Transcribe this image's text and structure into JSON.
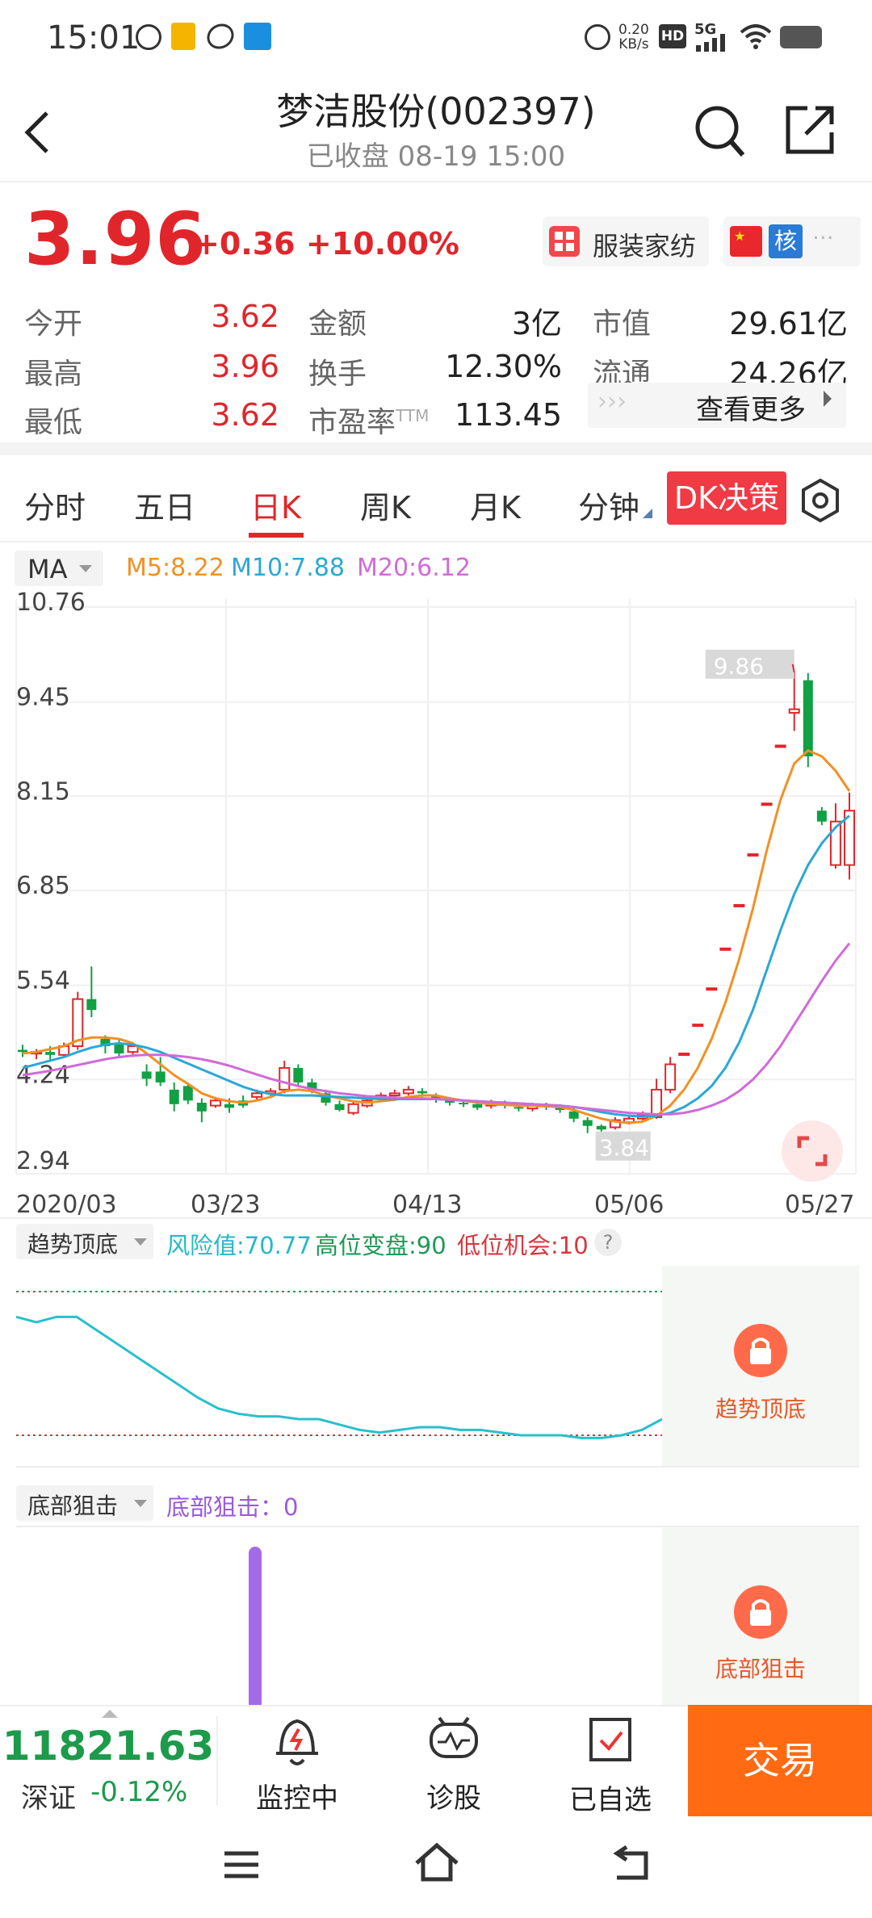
{
  "status_bar": {
    "time": "15:01",
    "net_speed_top": "0.20",
    "net_speed_bottom": "KB/s",
    "hd": "HD",
    "signal": "5G"
  },
  "header": {
    "title": "梦洁股份(002397)",
    "subtitle": "已收盘 08-19 15:00"
  },
  "quote": {
    "price": "3.96",
    "change": "+0.36",
    "change_pct": "+10.00%",
    "industry": "服装家纺",
    "badge_hu": "核",
    "dots": "···"
  },
  "stats": [
    [
      {
        "label": "今开",
        "value": "3.62",
        "red": true
      },
      {
        "label": "金额",
        "value": "3亿",
        "red": false
      },
      {
        "label": "市值",
        "value": "29.61亿",
        "red": false
      }
    ],
    [
      {
        "label": "最高",
        "value": "3.96",
        "red": true
      },
      {
        "label": "换手",
        "value": "12.30%",
        "red": false
      },
      {
        "label": "流通",
        "value": "24.26亿",
        "red": false
      }
    ],
    [
      {
        "label": "最低",
        "value": "3.62",
        "red": true
      },
      {
        "label": "市盈率",
        "label_sup": "TTM",
        "value": "113.45",
        "red": false
      },
      {
        "label": "查看更多",
        "value": "",
        "red": false
      }
    ]
  ],
  "tabs": [
    "分时",
    "五日",
    "日K",
    "周K",
    "月K",
    "分钟"
  ],
  "active_tab": "日K",
  "dk_button": "DK决策",
  "ma": {
    "selector": "MA",
    "m5": "M5:8.22",
    "m10": "M10:7.88",
    "m20": "M20:6.12",
    "c5": "#f29024",
    "c10": "#2aa8d6",
    "c20": "#d16ad8"
  },
  "chart_data": [
    {
      "type": "candlestick",
      "y_ticks": [
        "10.76",
        "9.45",
        "8.15",
        "6.85",
        "5.54",
        "4.24",
        "2.94"
      ],
      "ylim": [
        2.94,
        10.76
      ],
      "x_ticks": [
        "2020/03",
        "03/23",
        "04/13",
        "05/06",
        "05/27"
      ],
      "high_label": "9.86",
      "low_label": "3.84",
      "candles": [
        [
          4.65,
          4.62,
          4.72,
          4.55
        ],
        [
          4.6,
          4.62,
          4.66,
          4.52
        ],
        [
          4.62,
          4.58,
          4.7,
          4.5
        ],
        [
          4.58,
          4.7,
          4.75,
          4.55
        ],
        [
          4.7,
          5.35,
          5.45,
          4.65
        ],
        [
          5.35,
          5.2,
          5.8,
          5.1
        ],
        [
          4.8,
          4.7,
          4.85,
          4.6
        ],
        [
          4.75,
          4.6,
          4.8,
          4.55
        ],
        [
          4.62,
          4.7,
          4.74,
          4.55
        ],
        [
          4.35,
          4.25,
          4.45,
          4.15
        ],
        [
          4.35,
          4.2,
          4.55,
          4.15
        ],
        [
          4.1,
          3.9,
          4.2,
          3.8
        ],
        [
          4.15,
          3.95,
          4.2,
          3.9
        ],
        [
          3.92,
          3.8,
          3.98,
          3.65
        ],
        [
          3.88,
          3.95,
          4.0,
          3.85
        ],
        [
          3.9,
          3.85,
          3.98,
          3.78
        ],
        [
          3.95,
          3.88,
          4.02,
          3.85
        ],
        [
          4.0,
          4.05,
          4.1,
          3.95
        ],
        [
          4.05,
          4.08,
          4.12,
          4.0
        ],
        [
          4.1,
          4.4,
          4.5,
          4.05
        ],
        [
          4.4,
          4.2,
          4.45,
          4.15
        ],
        [
          4.2,
          4.1,
          4.25,
          4.05
        ],
        [
          4.05,
          3.92,
          4.1,
          3.88
        ],
        [
          3.9,
          3.82,
          3.95,
          3.8
        ],
        [
          3.78,
          3.9,
          3.95,
          3.75
        ],
        [
          3.88,
          3.95,
          4.0,
          3.85
        ],
        [
          3.98,
          4.02,
          4.06,
          3.96
        ],
        [
          4.02,
          4.05,
          4.1,
          4.0
        ],
        [
          4.05,
          4.1,
          4.15,
          4.02
        ],
        [
          4.08,
          4.05,
          4.12,
          4.0
        ],
        [
          4.02,
          3.96,
          4.05,
          3.92
        ],
        [
          3.96,
          3.92,
          4.0,
          3.88
        ],
        [
          3.92,
          3.9,
          3.96,
          3.86
        ],
        [
          3.9,
          3.85,
          3.95,
          3.82
        ],
        [
          3.88,
          3.92,
          3.96,
          3.84
        ],
        [
          3.9,
          3.88,
          3.95,
          3.84
        ],
        [
          3.86,
          3.84,
          3.9,
          3.8
        ],
        [
          3.84,
          3.88,
          3.92,
          3.8
        ],
        [
          3.88,
          3.86,
          3.92,
          3.82
        ],
        [
          3.85,
          3.82,
          3.9,
          3.78
        ],
        [
          3.8,
          3.7,
          3.85,
          3.65
        ],
        [
          3.68,
          3.6,
          3.72,
          3.5
        ],
        [
          3.6,
          3.55,
          3.62,
          3.52
        ],
        [
          3.58,
          3.68,
          3.72,
          3.55
        ],
        [
          3.65,
          3.7,
          3.75,
          3.62
        ],
        [
          3.7,
          3.75,
          3.8,
          3.68
        ],
        [
          3.72,
          4.1,
          4.25,
          3.7
        ],
        [
          4.1,
          4.45,
          4.55,
          4.05
        ],
        [
          4.6,
          4.6,
          4.6,
          4.6
        ],
        [
          5.0,
          5.0,
          5.0,
          5.0
        ],
        [
          5.5,
          5.5,
          5.5,
          5.5
        ],
        [
          6.05,
          6.05,
          6.05,
          6.05
        ],
        [
          6.65,
          6.65,
          6.65,
          6.65
        ],
        [
          7.35,
          7.35,
          7.35,
          7.35
        ],
        [
          8.05,
          8.05,
          8.05,
          8.05
        ],
        [
          8.85,
          8.85,
          8.85,
          8.85
        ],
        [
          9.3,
          9.35,
          9.86,
          9.05
        ],
        [
          9.75,
          8.7,
          9.85,
          8.55
        ],
        [
          7.95,
          7.8,
          8.0,
          7.75
        ],
        [
          7.2,
          7.8,
          8.05,
          7.15
        ],
        [
          7.2,
          7.95,
          8.2,
          7.0
        ]
      ],
      "ma5": [
        4.6,
        4.62,
        4.66,
        4.7,
        4.78,
        4.82,
        4.82,
        4.8,
        4.74,
        4.6,
        4.45,
        4.3,
        4.18,
        4.05,
        3.98,
        3.94,
        3.92,
        3.95,
        4.0,
        4.08,
        4.1,
        4.08,
        4.02,
        3.98,
        3.94,
        3.92,
        3.94,
        3.96,
        4.0,
        4.02,
        4.02,
        3.98,
        3.95,
        3.92,
        3.9,
        3.89,
        3.88,
        3.88,
        3.87,
        3.86,
        3.82,
        3.76,
        3.7,
        3.66,
        3.64,
        3.66,
        3.74,
        3.88,
        4.1,
        4.4,
        4.8,
        5.3,
        5.9,
        6.6,
        7.4,
        8.1,
        8.6,
        8.78,
        8.7,
        8.5,
        8.22
      ],
      "ma10": [
        4.4,
        4.45,
        4.5,
        4.55,
        4.62,
        4.68,
        4.72,
        4.74,
        4.72,
        4.68,
        4.62,
        4.54,
        4.46,
        4.38,
        4.3,
        4.22,
        4.14,
        4.08,
        4.04,
        4.02,
        4.02,
        4.02,
        4.01,
        4.0,
        3.99,
        3.98,
        3.97,
        3.97,
        3.97,
        3.97,
        3.97,
        3.96,
        3.95,
        3.94,
        3.93,
        3.92,
        3.91,
        3.9,
        3.89,
        3.88,
        3.86,
        3.83,
        3.79,
        3.76,
        3.74,
        3.73,
        3.74,
        3.78,
        3.86,
        3.98,
        4.15,
        4.4,
        4.75,
        5.2,
        5.75,
        6.3,
        6.8,
        7.2,
        7.5,
        7.72,
        7.88
      ],
      "ma20": [
        4.3,
        4.33,
        4.36,
        4.4,
        4.44,
        4.48,
        4.52,
        4.55,
        4.57,
        4.58,
        4.58,
        4.57,
        4.55,
        4.52,
        4.48,
        4.43,
        4.37,
        4.31,
        4.25,
        4.2,
        4.15,
        4.11,
        4.08,
        4.05,
        4.03,
        4.01,
        4.0,
        3.99,
        3.98,
        3.98,
        3.97,
        3.96,
        3.95,
        3.94,
        3.93,
        3.92,
        3.91,
        3.9,
        3.89,
        3.88,
        3.86,
        3.84,
        3.82,
        3.8,
        3.78,
        3.77,
        3.76,
        3.76,
        3.78,
        3.82,
        3.88,
        3.96,
        4.08,
        4.24,
        4.45,
        4.7,
        5.0,
        5.3,
        5.6,
        5.88,
        6.12
      ]
    },
    {
      "type": "line",
      "name": "趋势顶底",
      "values": [
        80,
        78,
        80,
        80,
        75,
        70,
        65,
        60,
        55,
        50,
        46,
        44,
        43,
        43,
        42,
        42,
        40,
        38,
        37,
        38,
        39,
        39,
        38,
        38,
        37,
        36,
        36,
        36,
        35,
        35,
        36,
        38,
        42
      ]
    }
  ],
  "indicator1": {
    "selector": "趋势顶底",
    "risk": "风险值:70.77",
    "high": "高位变盘:90",
    "low": "低位机会:10",
    "lock_label": "趋势顶底"
  },
  "indicator2": {
    "selector": "底部狙击",
    "value": "底部狙击：0",
    "lock_label": "底部狙击"
  },
  "bottom_bar": {
    "index_value": "11821.63",
    "index_name": "深证",
    "index_change": "-0.12%",
    "monitor": "监控中",
    "diagnose": "诊股",
    "watchlist": "已自选",
    "trade": "交易"
  }
}
